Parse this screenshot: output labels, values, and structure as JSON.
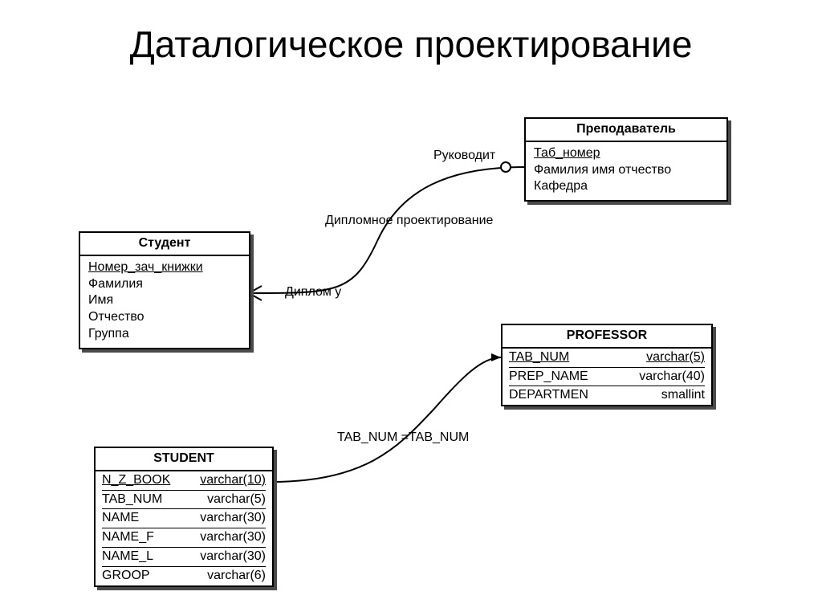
{
  "title": "Даталогическое проектирование",
  "entities": {
    "teacher": {
      "title": "Преподаватель",
      "attrs": [
        {
          "text": "Таб_номер",
          "pk": true
        },
        {
          "text": "Фамилия имя отчество",
          "pk": false
        },
        {
          "text": "Кафедра",
          "pk": false
        }
      ]
    },
    "student": {
      "title": "Студент",
      "attrs": [
        {
          "text": "Номер_зач_книжки",
          "pk": true
        },
        {
          "text": "Фамилия",
          "pk": false
        },
        {
          "text": "Имя",
          "pk": false
        },
        {
          "text": "Отчество",
          "pk": false
        },
        {
          "text": "Группа",
          "pk": false
        }
      ]
    },
    "professor": {
      "title": "PROFESSOR",
      "cols": [
        {
          "name": "TAB_NUM",
          "type": "varchar(5)",
          "pk": true
        },
        {
          "name": "PREP_NAME",
          "type": "varchar(40)",
          "pk": false
        },
        {
          "name": "DEPARTMEN",
          "type": "smallint",
          "pk": false
        }
      ]
    },
    "student_db": {
      "title": "STUDENT",
      "cols": [
        {
          "name": "N_Z_BOOK",
          "type": "varchar(10)",
          "pk": true
        },
        {
          "name": "TAB_NUM",
          "type": "varchar(5)",
          "pk": false
        },
        {
          "name": "NAME",
          "type": "varchar(30)",
          "pk": false
        },
        {
          "name": "NAME_F",
          "type": "varchar(30)",
          "pk": false
        },
        {
          "name": "NAME_L",
          "type": "varchar(30)",
          "pk": false
        },
        {
          "name": "GROOP",
          "type": "varchar(6)",
          "pk": false
        }
      ]
    }
  },
  "labels": {
    "guides": "Руководит",
    "diploma_design": "Дипломное проектирование",
    "diploma_at": "Диплом у",
    "fk_join": "TAB_NUM =TAB_NUM"
  }
}
